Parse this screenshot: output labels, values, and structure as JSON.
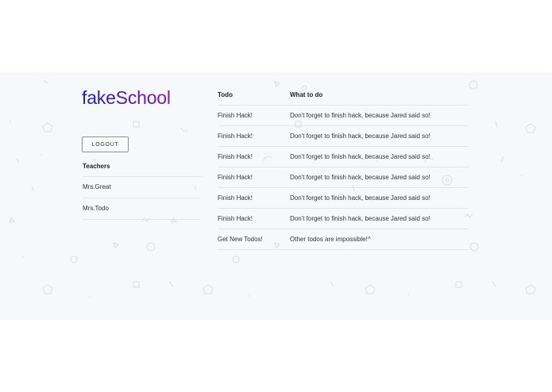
{
  "brand": {
    "logo_text": "fakeSchool"
  },
  "actions": {
    "logout_label": "LOGOUT"
  },
  "teachers": {
    "heading": "Teachers",
    "items": [
      "Mrs.Great",
      "Mrs.Todo"
    ]
  },
  "todos": {
    "headers": {
      "todo": "Todo",
      "what": "What to do"
    },
    "rows": [
      {
        "todo": "Finish Hack!",
        "what": "Don't forget to finish hack, because Jared said so!"
      },
      {
        "todo": "Finish Hack!",
        "what": "Don't forget to finish hack, because Jared said so!"
      },
      {
        "todo": "Finish Hack!",
        "what": "Don't forget to finish hack, because Jared said so!"
      },
      {
        "todo": "Finish Hack!",
        "what": "Don't forget to finish hack, because Jared said so!"
      },
      {
        "todo": "Finish Hack!",
        "what": "Don't forget to finish hack, because Jared said so!"
      },
      {
        "todo": "Finish Hack!",
        "what": "Don't forget to finish hack, because Jared said so!"
      },
      {
        "todo": "Get New Todos!",
        "what": "Other todos are impossible!^"
      }
    ]
  },
  "colors": {
    "background_band": "#f7f8fa",
    "logo_gradient_start": "#1b1fbf",
    "logo_gradient_end": "#8a1aa0",
    "divider": "#e2e4e8",
    "pattern_shape": "#e1e4ea"
  }
}
